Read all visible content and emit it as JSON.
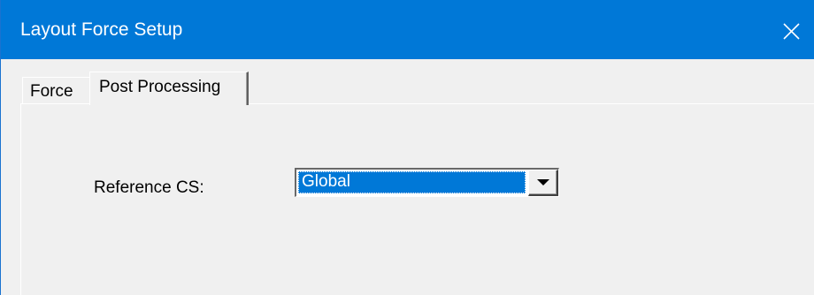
{
  "window": {
    "title": "Layout Force Setup",
    "close_icon": "close-icon",
    "titlebar_color": "#0078d7"
  },
  "tabs": [
    {
      "label": "Force",
      "active": false
    },
    {
      "label": "Post Processing",
      "active": true
    }
  ],
  "post_processing": {
    "reference_cs_label": "Reference CS:",
    "reference_cs_value": "Global",
    "dropdown_icon": "chevron-down-icon",
    "selection_color": "#0078d7"
  }
}
